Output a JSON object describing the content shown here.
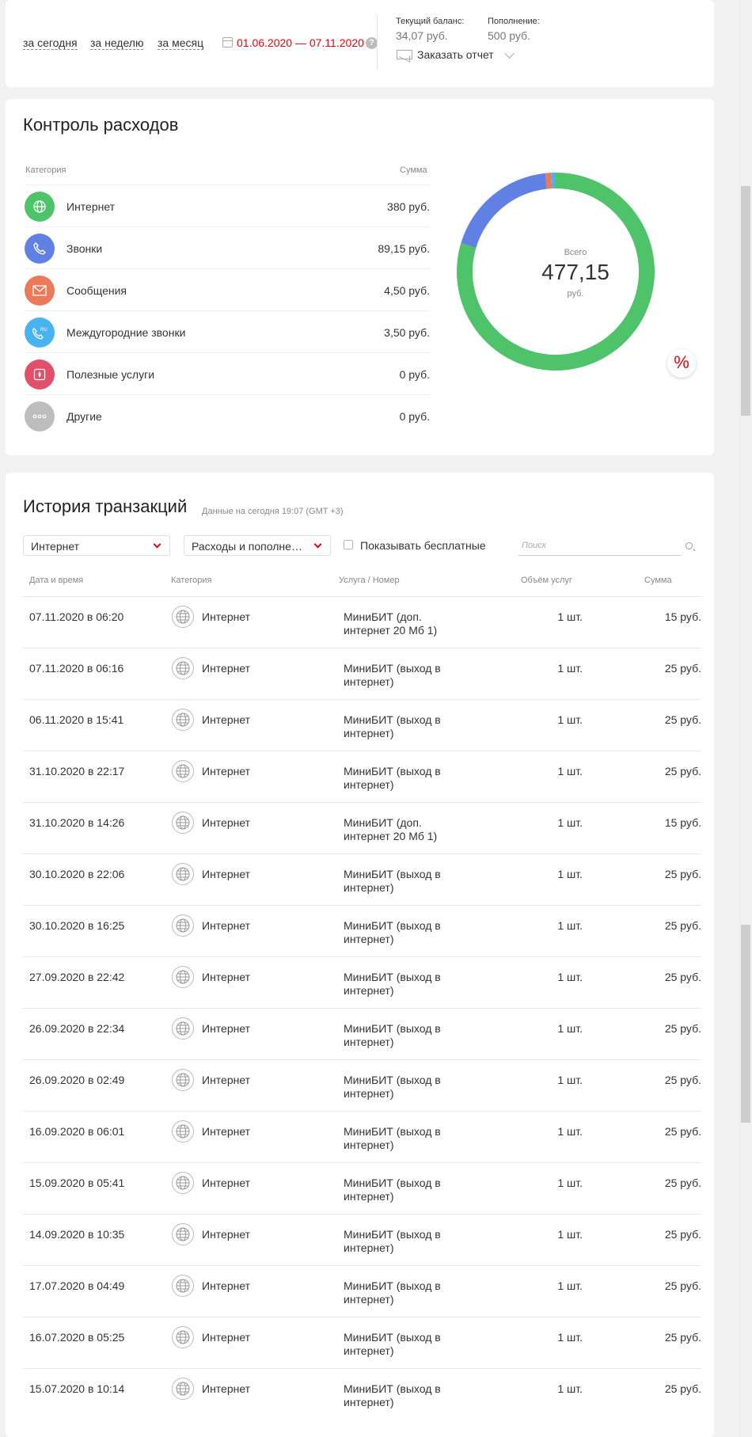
{
  "period": {
    "today": "за сегодня",
    "week": "за неделю",
    "month": "за месяц",
    "date_range": "01.06.2020 — 07.11.2020",
    "help": "?"
  },
  "balance": {
    "current_label": "Текущий баланс:",
    "current_value": "34,07 руб.",
    "topup_label": "Пополнение:",
    "topup_value": "500 руб.",
    "report": "Заказать отчет"
  },
  "spending": {
    "title": "Контроль расходов",
    "col_category": "Категория",
    "col_sum": "Сумма",
    "categories": [
      {
        "name": "Интернет",
        "sum": "380 руб.",
        "icon": "globe-icon",
        "color": "#4fc36a"
      },
      {
        "name": "Звонки",
        "sum": "89,15 руб.",
        "icon": "phone-icon",
        "color": "#6081e3"
      },
      {
        "name": "Сообщения",
        "sum": "4,50 руб.",
        "icon": "envelope-icon",
        "color": "#eb7a5a"
      },
      {
        "name": "Междугородние звонки",
        "sum": "3,50 руб.",
        "icon": "phone-ru-icon",
        "color": "#47b4f0"
      },
      {
        "name": "Полезные услуги",
        "sum": "0 руб.",
        "icon": "service-icon",
        "color": "#e0506a"
      },
      {
        "name": "Другие",
        "sum": "0 руб.",
        "icon": "dots-icon",
        "color": "#bdbdbd"
      }
    ],
    "total_label": "Всего",
    "total_value": "477,15",
    "total_unit": "руб.",
    "percent_badge": "%"
  },
  "chart_data": {
    "type": "pie",
    "categories": [
      "Интернет",
      "Звонки",
      "Сообщения",
      "Междугородние звонки",
      "Полезные услуги",
      "Другие"
    ],
    "values": [
      380,
      89.15,
      4.5,
      3.5,
      0,
      0
    ],
    "colors": [
      "#4fc36a",
      "#6081e3",
      "#eb7a5a",
      "#47b4f0",
      "#e0506a",
      "#bdbdbd"
    ],
    "center_text": "Всего 477,15 руб."
  },
  "history": {
    "title": "История транзакций",
    "subtitle": "Данные на сегодня 19:07 (GMT +3)",
    "filter_category": "Интернет",
    "filter_type": "Расходы и пополнения",
    "show_free": "Показывать бесплатные",
    "search_placeholder": "Поиск",
    "columns": [
      "Дата и время",
      "Категория",
      "Услуга / Номер",
      "Объём услуг",
      "Сумма"
    ],
    "rows": [
      {
        "date": "07.11.2020 в 06:20",
        "category": "Интернет",
        "service": "МиниБИТ (доп. интернет 20 Мб 1)",
        "volume": "1 шт.",
        "sum": "15 руб."
      },
      {
        "date": "07.11.2020 в 06:16",
        "category": "Интернет",
        "service": "МиниБИТ (выход в интернет)",
        "volume": "1 шт.",
        "sum": "25 руб."
      },
      {
        "date": "06.11.2020 в 15:41",
        "category": "Интернет",
        "service": "МиниБИТ (выход в интернет)",
        "volume": "1 шт.",
        "sum": "25 руб."
      },
      {
        "date": "31.10.2020 в 22:17",
        "category": "Интернет",
        "service": "МиниБИТ (выход в интернет)",
        "volume": "1 шт.",
        "sum": "25 руб."
      },
      {
        "date": "31.10.2020 в 14:26",
        "category": "Интернет",
        "service": "МиниБИТ (доп. интернет 20 Мб 1)",
        "volume": "1 шт.",
        "sum": "15 руб."
      },
      {
        "date": "30.10.2020 в 22:06",
        "category": "Интернет",
        "service": "МиниБИТ (выход в интернет)",
        "volume": "1 шт.",
        "sum": "25 руб."
      },
      {
        "date": "30.10.2020 в 16:25",
        "category": "Интернет",
        "service": "МиниБИТ (выход в интернет)",
        "volume": "1 шт.",
        "sum": "25 руб."
      },
      {
        "date": "27.09.2020 в 22:42",
        "category": "Интернет",
        "service": "МиниБИТ (выход в интернет)",
        "volume": "1 шт.",
        "sum": "25 руб."
      },
      {
        "date": "26.09.2020 в 22:34",
        "category": "Интернет",
        "service": "МиниБИТ (выход в интернет)",
        "volume": "1 шт.",
        "sum": "25 руб."
      },
      {
        "date": "26.09.2020 в 02:49",
        "category": "Интернет",
        "service": "МиниБИТ (выход в интернет)",
        "volume": "1 шт.",
        "sum": "25 руб."
      },
      {
        "date": "16.09.2020 в 06:01",
        "category": "Интернет",
        "service": "МиниБИТ (выход в интернет)",
        "volume": "1 шт.",
        "sum": "25 руб."
      },
      {
        "date": "15.09.2020 в 05:41",
        "category": "Интернет",
        "service": "МиниБИТ (выход в интернет)",
        "volume": "1 шт.",
        "sum": "25 руб."
      },
      {
        "date": "14.09.2020 в 10:35",
        "category": "Интернет",
        "service": "МиниБИТ (выход в интернет)",
        "volume": "1 шт.",
        "sum": "25 руб."
      },
      {
        "date": "17.07.2020 в 04:49",
        "category": "Интернет",
        "service": "МиниБИТ (выход в интернет)",
        "volume": "1 шт.",
        "sum": "25 руб."
      },
      {
        "date": "16.07.2020 в 05:25",
        "category": "Интернет",
        "service": "МиниБИТ (выход в интернет)",
        "volume": "1 шт.",
        "sum": "25 руб."
      },
      {
        "date": "15.07.2020 в 10:14",
        "category": "Интернет",
        "service": "МиниБИТ (выход в интернет)",
        "volume": "1 шт.",
        "sum": "25 руб."
      }
    ]
  }
}
